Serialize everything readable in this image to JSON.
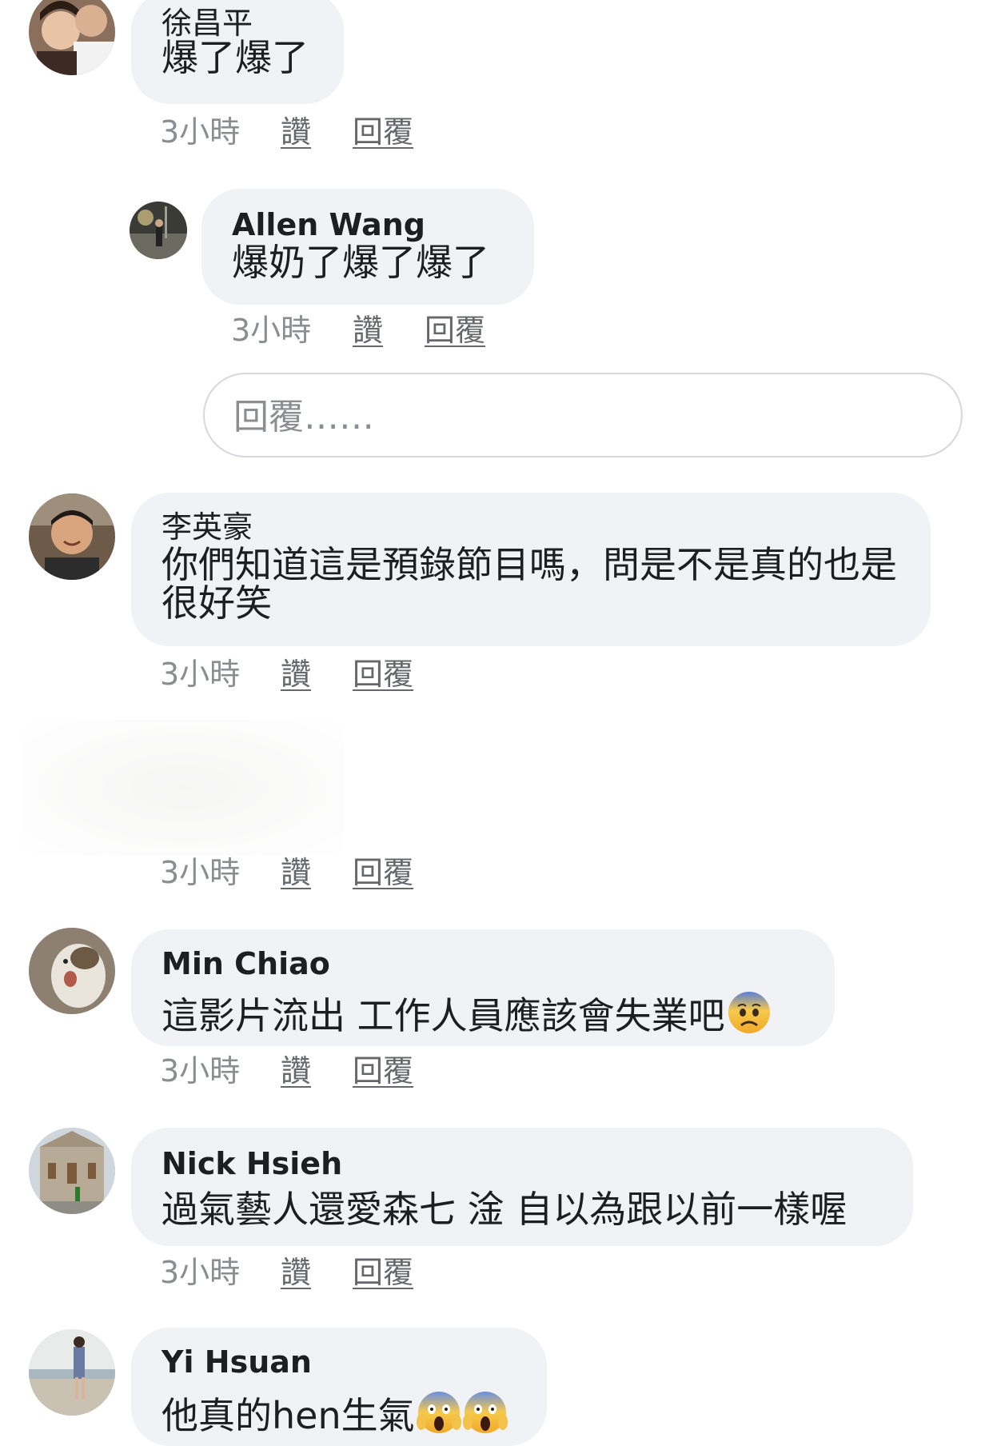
{
  "comments": [
    {
      "author": "徐昌平",
      "text": "爆了爆了",
      "time": "3小時",
      "like": "讚",
      "reply": "回覆",
      "avatar": "avatar-couple-photo"
    },
    {
      "author": "Allen Wang",
      "text": "爆奶了爆了爆了",
      "time": "3小時",
      "like": "讚",
      "reply": "回覆",
      "avatar": "avatar-night-street-photo"
    },
    {
      "author": "李英豪",
      "text": "你們知道這是預錄節目嗎，問是不是真的也是很好笑",
      "time": "3小時",
      "like": "讚",
      "reply": "回覆",
      "avatar": "avatar-young-man-photo"
    },
    {
      "time": "3小時",
      "like": "讚",
      "reply": "回覆"
    },
    {
      "author": "Min Chiao",
      "text": "這影片流出 工作人員應該會失業吧",
      "emoji": "fearful-face-emoji",
      "time": "3小時",
      "like": "讚",
      "reply": "回覆",
      "avatar": "avatar-cat-photo"
    },
    {
      "author": "Nick Hsieh",
      "text": "過氣藝人還愛森七 淦 自以為跟以前一樣喔",
      "time": "3小時",
      "like": "讚",
      "reply": "回覆",
      "avatar": "avatar-building-photo"
    },
    {
      "author": "Yi Hsuan",
      "text": "他真的hen生氣",
      "emoji": "screaming-face-emoji",
      "time": "3小時",
      "like": "讚",
      "reply": "回覆",
      "avatar": "avatar-beach-photo"
    }
  ],
  "reply_input": {
    "placeholder": "回覆……"
  },
  "colors": {
    "bubble": "#f0f2f5",
    "meta_text": "#8a8d91",
    "name_text": "#1c1e21"
  }
}
